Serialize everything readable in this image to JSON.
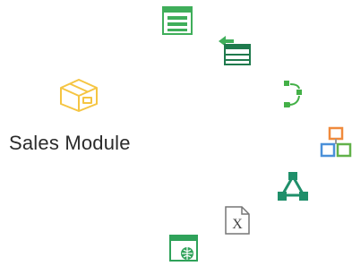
{
  "module": {
    "label": "Sales Module",
    "icon": "package-box-icon",
    "icon_color": "#f5c542"
  },
  "orbit_icons": [
    {
      "name": "list-window-icon",
      "color": "#3fae5a"
    },
    {
      "name": "import-table-icon",
      "color": "#2f9e5c"
    },
    {
      "name": "workflow-arrow-icon",
      "color": "#43b047"
    },
    {
      "name": "hierarchy-blocks-icon",
      "colors": [
        "#f08a3c",
        "#4a90d9",
        "#62b14a"
      ]
    },
    {
      "name": "network-triangle-icon",
      "color": "#1f8f6a"
    },
    {
      "name": "excel-file-icon",
      "color": "#555555"
    },
    {
      "name": "web-window-icon",
      "color": "#2fa25a"
    }
  ]
}
